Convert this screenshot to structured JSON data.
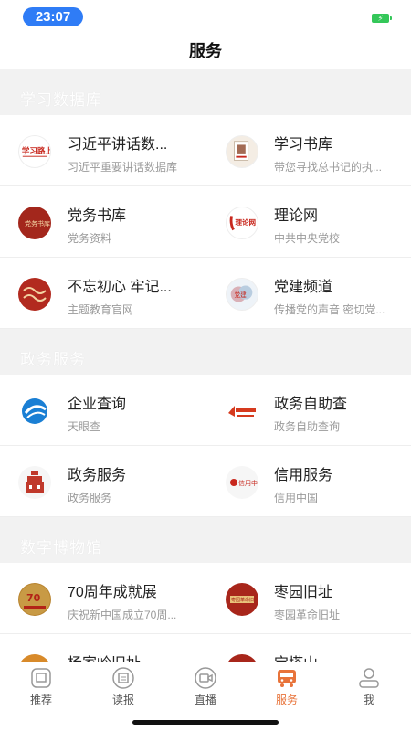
{
  "status": {
    "time": "23:07",
    "battery_color": "#34c759",
    "time_pill_color": "#2f7cf6"
  },
  "header": {
    "title": "服务"
  },
  "sections": [
    {
      "title": "学习数据库",
      "items": [
        {
          "name": "习近平讲话数...",
          "desc": "习近平重要讲话数据库",
          "icon": "xuexi-lushang-logo"
        },
        {
          "name": "学习书库",
          "desc": "带您寻找总书记的执...",
          "icon": "book-cover-logo"
        },
        {
          "name": "党务书库",
          "desc": "党务资料",
          "icon": "party-book-logo"
        },
        {
          "name": "理论网",
          "desc": "中共中央党校",
          "icon": "lilun-wang-logo"
        },
        {
          "name": "不忘初心 牢记...",
          "desc": "主题教育官网",
          "icon": "buwang-chuxin-logo"
        },
        {
          "name": "党建频道",
          "desc": "传播党的声音 密切党...",
          "icon": "dangjian-pindao-logo"
        }
      ]
    },
    {
      "title": "政务服务",
      "items": [
        {
          "name": "企业查询",
          "desc": "天眼查",
          "icon": "tianyancha-logo"
        },
        {
          "name": "政务自助查",
          "desc": "政务自助查询",
          "icon": "zhengwu-zizhu-logo"
        },
        {
          "name": "政务服务",
          "desc": "政务服务",
          "icon": "zhengwu-fuwu-logo"
        },
        {
          "name": "信用服务",
          "desc": "信用中国",
          "icon": "xinyong-zhongguo-logo"
        }
      ]
    },
    {
      "title": "数字博物馆",
      "items": [
        {
          "name": "70周年成就展",
          "desc": "庆祝新中国成立70周...",
          "icon": "70-anniversary-logo"
        },
        {
          "name": "枣园旧址",
          "desc": "枣园革命旧址",
          "icon": "zaoyuan-logo"
        },
        {
          "name": "杨家岭旧址",
          "desc": "",
          "icon": "yangjialing-logo"
        },
        {
          "name": "宝塔山",
          "desc": "",
          "icon": "baotashan-logo"
        }
      ]
    }
  ],
  "tabs": [
    {
      "label": "推荐",
      "icon": "recommend-icon",
      "active": false
    },
    {
      "label": "读报",
      "icon": "newspaper-icon",
      "active": false
    },
    {
      "label": "直播",
      "icon": "live-video-icon",
      "active": false
    },
    {
      "label": "服务",
      "icon": "bus-service-icon",
      "active": true
    },
    {
      "label": "我",
      "icon": "profile-icon",
      "active": false
    }
  ],
  "colors": {
    "accent": "#e8733a",
    "section_bg": "#f2f2f2"
  }
}
